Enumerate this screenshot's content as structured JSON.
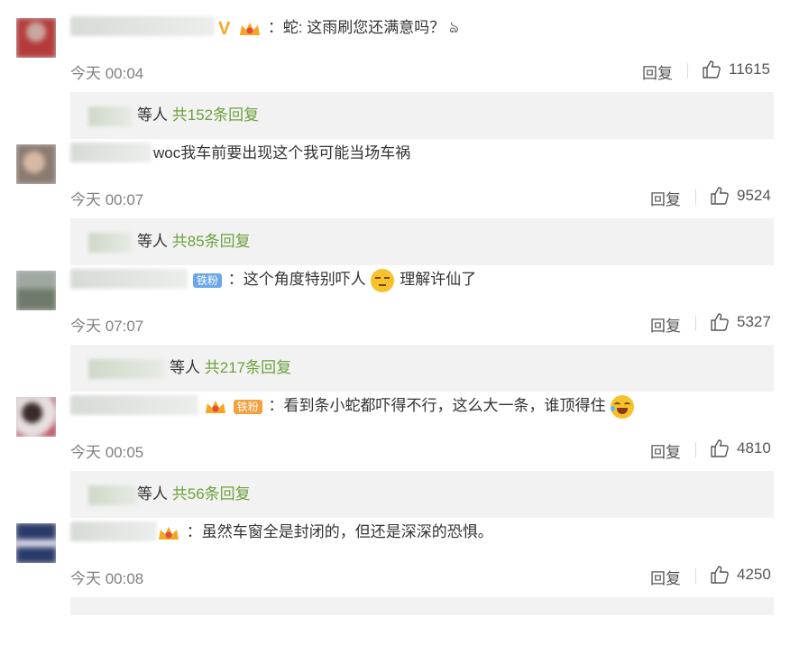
{
  "comments": [
    {
      "text": "：蛇: 这雨刷您还满意吗？",
      "time": "今天 00:04",
      "reply_label": "回复",
      "likes": "11615",
      "sub_others": "等人",
      "sub_count": "共152条回复",
      "badge": "V"
    },
    {
      "text": "woc我车前要出现这个我可能当场车祸",
      "time": "今天 00:07",
      "reply_label": "回复",
      "likes": "9524",
      "sub_others": "等人",
      "sub_count": "共85条回复"
    },
    {
      "text_a": "：这个角度特别吓人",
      "text_b": "理解许仙了",
      "fan_badge": "铁粉",
      "time": "今天 07:07",
      "reply_label": "回复",
      "likes": "5327",
      "sub_others": "等人",
      "sub_count": "共217条回复"
    },
    {
      "text": "：看到条小蛇都吓得不行，这么大一条，谁顶得住",
      "fan_badge": "铁粉",
      "time": "今天 00:05",
      "reply_label": "回复",
      "likes": "4810",
      "sub_others": "等人",
      "sub_count": "共56条回复"
    },
    {
      "text": "：虽然车窗全是封闭的，但还是深深的恐惧。",
      "time": "今天 00:08",
      "reply_label": "回复",
      "likes": "4250"
    }
  ],
  "colors": {
    "reply_count_green": "#6ca13c",
    "badge_gold": "#f5a623",
    "fan_blue": "#6aa7e8",
    "fan_orange": "#f5a03a",
    "subreply_bg": "#f2f2f2"
  },
  "icons": {
    "like": "thumbs-up-icon",
    "crown": "crown-icon",
    "emoji": "face-emoji-icon"
  }
}
